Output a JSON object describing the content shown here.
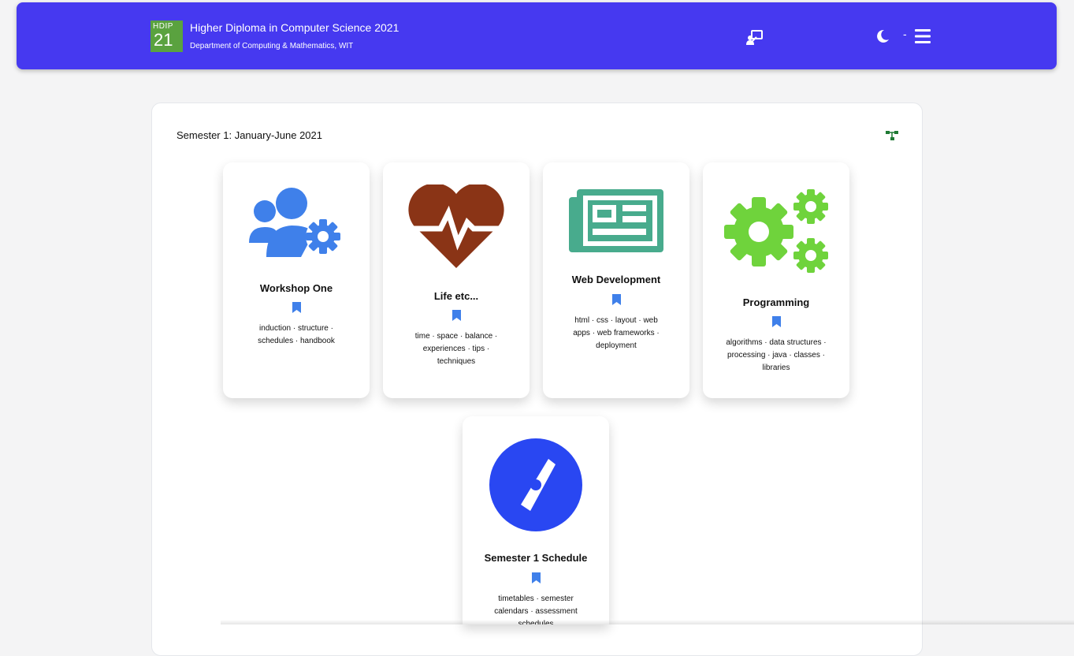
{
  "header": {
    "logo_top": "HDIP",
    "logo_bottom": "21",
    "title": "Higher Diploma in Computer Science 2021",
    "subtitle": "Department of Computing & Mathematics, WIT",
    "separator": "-"
  },
  "section": {
    "title": "Semester 1: January-June 2021"
  },
  "cards": [
    {
      "title": "Workshop One",
      "icon": "user-gear-icon",
      "color": "#3f80ea",
      "text": "induction · structure · schedules · handbook"
    },
    {
      "title": "Life etc...",
      "icon": "heart-pulse-icon",
      "color": "#8a3416",
      "text": "time · space · balance · experiences · tips · techniques"
    },
    {
      "title": "Web Development",
      "icon": "newspaper-icon",
      "color": "#48ab8d",
      "text": "html · css · layout · web apps · web frameworks · deployment"
    },
    {
      "title": "Programming",
      "icon": "cogs-icon",
      "color": "#6fd33c",
      "text": "algorithms · data structures · processing · java · classes · libraries"
    },
    {
      "title": "Semester 1 Schedule",
      "icon": "compass-icon",
      "color": "#2947f2",
      "text": "timetables · semester calendars · assessment schedules"
    }
  ],
  "colors": {
    "navbar": "#4639f0",
    "bookmark": "#3f80ea",
    "tree": "#1f7a34"
  }
}
